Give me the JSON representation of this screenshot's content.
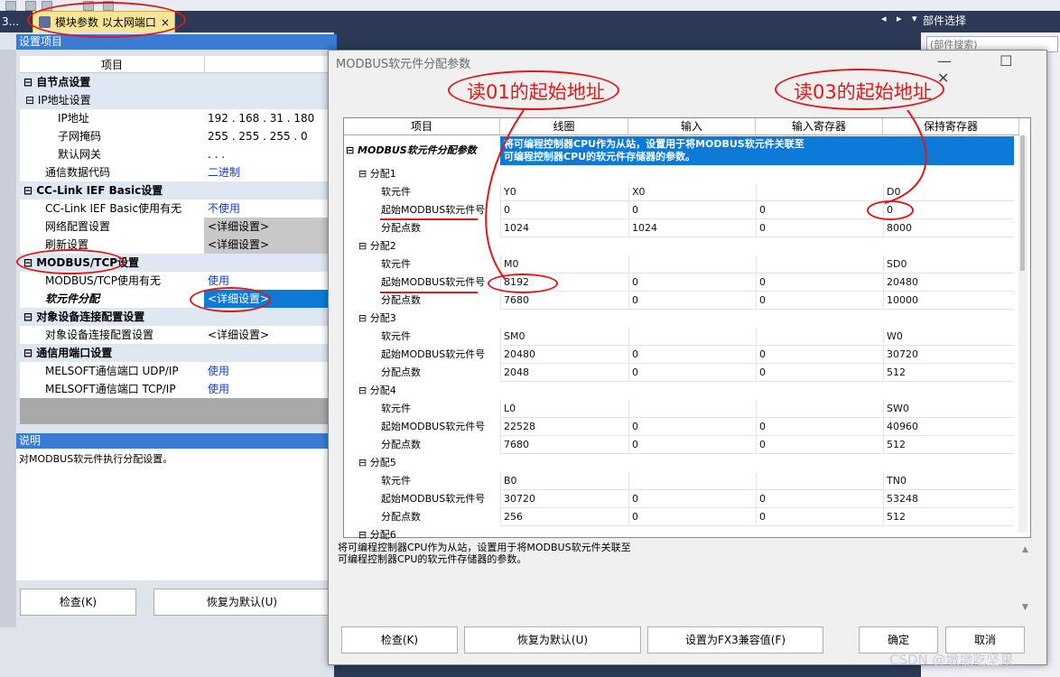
{
  "tabs": {
    "left_stub": "3...",
    "active_label": "模块参数 以太网端口",
    "close_glyph": "×",
    "nav": "◂ ▸ ▾",
    "right_panel_title": "部件选择",
    "right_search_placeholder": "(部件搜索)"
  },
  "left": {
    "title": "设置项目",
    "header": "项目",
    "rows": [
      {
        "name": "⊟ 自节点设置",
        "value": "",
        "type": "cat"
      },
      {
        "name": "  ⊟ IP地址设置",
        "value": "",
        "type": "sub"
      },
      {
        "name": "IP地址",
        "value": "192 . 168 . 31 . 180",
        "type": "item"
      },
      {
        "name": "子网掩码",
        "value": "255 . 255 . 255 .  0",
        "type": "item"
      },
      {
        "name": "默认网关",
        "value": " .  .  . ",
        "type": "item"
      },
      {
        "name": "通信数据代码",
        "value": "二进制",
        "type": "item1"
      },
      {
        "name": "⊟ CC-Link IEF Basic设置",
        "value": "",
        "type": "cat"
      },
      {
        "name": "CC-Link IEF Basic使用有无",
        "value": "不使用",
        "type": "item1"
      },
      {
        "name": "网络配置设置",
        "value": "<详细设置>",
        "type": "item1g"
      },
      {
        "name": "刷新设置",
        "value": "<详细设置>",
        "type": "item1g"
      },
      {
        "name": "⊟ MODBUS/TCP设置",
        "value": "",
        "type": "cat"
      },
      {
        "name": "MODBUS/TCP使用有无",
        "value": "使用",
        "type": "item1"
      },
      {
        "name": "软元件分配",
        "value": "<详细设置>",
        "type": "item1s"
      },
      {
        "name": "⊟ 对象设备连接配置设置",
        "value": "",
        "type": "cat"
      },
      {
        "name": "对象设备连接配置设置",
        "value": "<详细设置>",
        "type": "item1"
      },
      {
        "name": "⊟ 通信用端口设置",
        "value": "",
        "type": "cat"
      },
      {
        "name": "MELSOFT通信端口 UDP/IP",
        "value": "使用",
        "type": "item1"
      },
      {
        "name": "MELSOFT通信端口 TCP/IP",
        "value": "使用",
        "type": "item1"
      }
    ],
    "desc_title": "说明",
    "desc_text": "对MODBUS软元件执行分配设置。",
    "btn_check": "检查(K)",
    "btn_default": "恢复为默认(U)"
  },
  "modal": {
    "title": "MODBUS软元件分配参数",
    "controls": "— ☐ ✕",
    "headers": [
      "项目",
      "线圈",
      "输入",
      "输入寄存器",
      "保持寄存器"
    ],
    "root_label": "⊟ MODBUS软元件分配参数",
    "banner_line1": "将可编程控制器CPU作为从站，设置用于将MODBUS软元件关联至",
    "banner_line2": "可编程控制器CPU的软元件存储器的参数。",
    "rows": [
      {
        "label": "⊟ 分配1",
        "kind": "group",
        "v": [
          "",
          "",
          "",
          ""
        ]
      },
      {
        "label": "软元件",
        "kind": "item",
        "v": [
          "Y0",
          "X0",
          "",
          "D0"
        ]
      },
      {
        "label": "起始MODBUS软元件号",
        "kind": "item",
        "v": [
          "0",
          "0",
          "0",
          "0"
        ]
      },
      {
        "label": "分配点数",
        "kind": "item",
        "v": [
          "1024",
          "1024",
          "0",
          "8000"
        ]
      },
      {
        "label": "⊟ 分配2",
        "kind": "group",
        "v": [
          "",
          "",
          "",
          ""
        ]
      },
      {
        "label": "软元件",
        "kind": "item",
        "v": [
          "M0",
          "",
          "",
          "SD0"
        ]
      },
      {
        "label": "起始MODBUS软元件号",
        "kind": "item",
        "v": [
          "8192",
          "0",
          "0",
          "20480"
        ]
      },
      {
        "label": "分配点数",
        "kind": "item",
        "v": [
          "7680",
          "0",
          "0",
          "10000"
        ]
      },
      {
        "label": "⊟ 分配3",
        "kind": "group",
        "v": [
          "",
          "",
          "",
          ""
        ]
      },
      {
        "label": "软元件",
        "kind": "item",
        "v": [
          "SM0",
          "",
          "",
          "W0"
        ]
      },
      {
        "label": "起始MODBUS软元件号",
        "kind": "item",
        "v": [
          "20480",
          "0",
          "0",
          "30720"
        ]
      },
      {
        "label": "分配点数",
        "kind": "item",
        "v": [
          "2048",
          "0",
          "0",
          "512"
        ]
      },
      {
        "label": "⊟ 分配4",
        "kind": "group",
        "v": [
          "",
          "",
          "",
          ""
        ]
      },
      {
        "label": "软元件",
        "kind": "item",
        "v": [
          "L0",
          "",
          "",
          "SW0"
        ]
      },
      {
        "label": "起始MODBUS软元件号",
        "kind": "item",
        "v": [
          "22528",
          "0",
          "0",
          "40960"
        ]
      },
      {
        "label": "分配点数",
        "kind": "item",
        "v": [
          "7680",
          "0",
          "0",
          "512"
        ]
      },
      {
        "label": "⊟ 分配5",
        "kind": "group",
        "v": [
          "",
          "",
          "",
          ""
        ]
      },
      {
        "label": "软元件",
        "kind": "item",
        "v": [
          "B0",
          "",
          "",
          "TN0"
        ]
      },
      {
        "label": "起始MODBUS软元件号",
        "kind": "item",
        "v": [
          "30720",
          "0",
          "0",
          "53248"
        ]
      },
      {
        "label": "分配点数",
        "kind": "item",
        "v": [
          "256",
          "0",
          "0",
          "512"
        ]
      },
      {
        "label": "⊟ 分配6",
        "kind": "group",
        "v": [
          "",
          "",
          "",
          ""
        ]
      }
    ],
    "desc_line1": "将可编程控制器CPU作为从站，设置用于将MODBUS软元件关联至",
    "desc_line2": "可编程控制器CPU的软元件存储器的参数。",
    "btn_check": "检查(K)",
    "btn_default": "恢复为默认(U)",
    "btn_fx3": "设置为FX3兼容值(F)",
    "btn_ok": "确定",
    "btn_cancel": "取消"
  },
  "annotations": {
    "read01": "读01的起始地址",
    "read03": "读03的起始地址"
  },
  "watermark": "CSDN @墩墩吃坚果",
  "colors": {
    "accent": "#0c7ad6",
    "annotation": "#e01818",
    "tab_active": "#f8e59a"
  }
}
